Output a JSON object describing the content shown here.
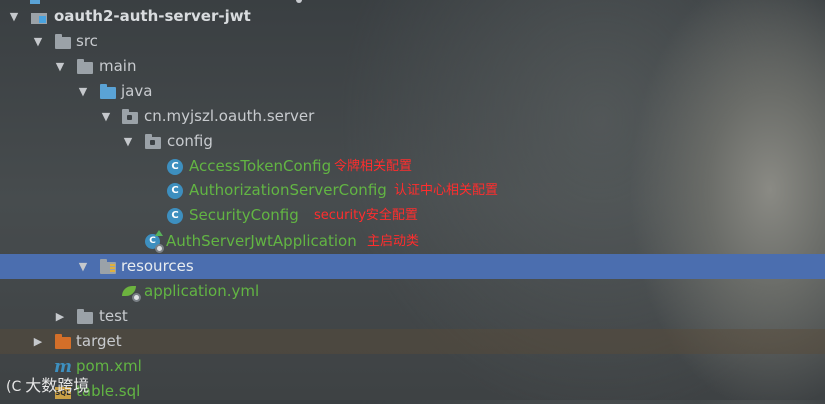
{
  "tree": {
    "project": "oauth2-auth-server-jwt",
    "src": "src",
    "main": "main",
    "java": "java",
    "package": "cn.myjszl.oauth.server",
    "config": "config",
    "classes": [
      {
        "name": "AccessTokenConfig",
        "note": "令牌相关配置"
      },
      {
        "name": "AuthorizationServerConfig",
        "note": "认证中心相关配置"
      },
      {
        "name": "SecurityConfig",
        "note": "security安全配置"
      }
    ],
    "app_class": {
      "name": "AuthServerJwtApplication",
      "note": "主启动类"
    },
    "resources": "resources",
    "application_yml": "application.yml",
    "test": "test",
    "target": "target",
    "pom": "pom.xml",
    "sql": "table.sql"
  },
  "icons": {
    "class": "C",
    "maven": "m",
    "sql": "SQL"
  },
  "watermark": {
    "text": "大数跨境",
    "logo": "(C"
  },
  "colors": {
    "selection": "#4b6eaf",
    "annotation": "#ff2d2d",
    "vcs_added": "#62b543"
  }
}
